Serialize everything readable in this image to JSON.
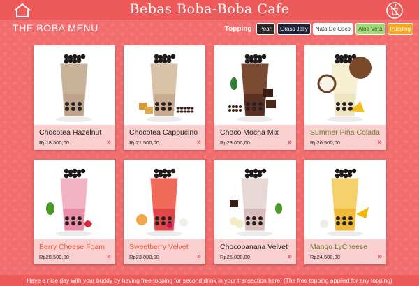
{
  "header": {
    "app_title": "Bebas Boba-Boba Cafe",
    "home_icon": "home-icon",
    "logo_icon": "no-straw-logo-icon"
  },
  "menu": {
    "title": "THE BOBA MENU"
  },
  "topping": {
    "label": "Topping",
    "options": [
      {
        "label": "Pearl",
        "bg": "#2b2727",
        "fg": "#ffffff"
      },
      {
        "label": "Grass Jelly",
        "bg": "#1c2438",
        "fg": "#ffffff"
      },
      {
        "label": "Nata De Coco",
        "bg": "#ffffff",
        "fg": "#333333"
      },
      {
        "label": "Aloe Vera",
        "bg": "#a3d977",
        "fg": "#2d4a1a"
      },
      {
        "label": "Pudding",
        "bg": "#f5a623",
        "fg": "#ffffff"
      }
    ]
  },
  "products": [
    {
      "name": "Chocotea Hazelnut",
      "price": "Rp18.500,00",
      "name_color": "#222222",
      "drink": "#c9b29a",
      "cup_bottom": "#bfa38a",
      "extra": "",
      "arrow": "chevron-right-icon"
    },
    {
      "name": "Chocotea Cappucino",
      "price": "Rp21.500,00",
      "name_color": "#222222",
      "drink": "#d8c2a8",
      "cup_bottom": "#c9ab8f",
      "extra": "coffee",
      "arrow": "chevron-right-icon"
    },
    {
      "name": "Choco Mocha Mix",
      "price": "Rp23.000,00",
      "name_color": "#222222",
      "drink": "#7a4a32",
      "cup_bottom": "#5a3020",
      "extra": "chocolate",
      "arrow": "chevron-right-icon"
    },
    {
      "name": "Summer Piña Colada",
      "price": "Rp26.500,00",
      "name_color": "#6e7a2a",
      "drink": "#f7efd2",
      "cup_bottom": "#efe4c0",
      "extra": "coconut",
      "arrow": "chevron-right-icon"
    },
    {
      "name": "Berry Cheese Foam",
      "price": "Rp20.500,00",
      "name_color": "#e85a3a",
      "drink": "#f2b4c4",
      "cup_bottom": "#e98ea6",
      "extra": "strawberry",
      "arrow": "chevron-right-icon"
    },
    {
      "name": "Sweetberry Velvet",
      "price": "Rp23.000,00",
      "name_color": "#e85a3a",
      "drink": "#f06a5a",
      "cup_bottom": "#e2484a",
      "extra": "peach",
      "arrow": "chevron-right-icon"
    },
    {
      "name": "Chocobanana Velvet",
      "price": "Rp25.000,00",
      "name_color": "#222222",
      "drink": "#e7d7d7",
      "cup_bottom": "#d9bcbc",
      "extra": "banana",
      "arrow": "chevron-right-icon"
    },
    {
      "name": "Mango LyCheese",
      "price": "Rp24.500,00",
      "name_color": "#6e7a2a",
      "drink": "#f6d06a",
      "cup_bottom": "#f0b93a",
      "extra": "mango",
      "arrow": "chevron-right-icon"
    }
  ],
  "footer": {
    "promo": "Have a nice day with your buddy by having free topping for second drink in your transaction here! (The free topping applied for any topping)"
  }
}
